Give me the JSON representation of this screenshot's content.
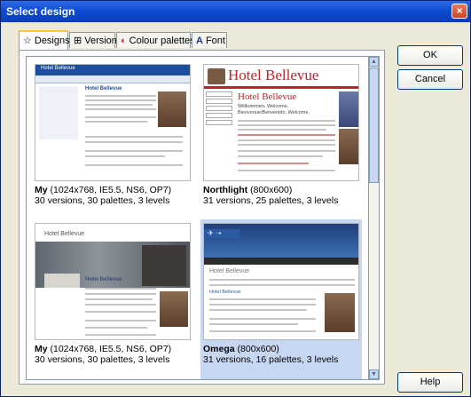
{
  "window": {
    "title": "Select design",
    "close_glyph": "×"
  },
  "tabs": [
    {
      "label": "Designs",
      "icon": "star-icon"
    },
    {
      "label": "Versions",
      "icon": "grid-icon"
    },
    {
      "label": "Colour palettes",
      "icon": "palette-icon"
    },
    {
      "label": "Font",
      "icon": "font-icon"
    }
  ],
  "designs": [
    {
      "name": "My",
      "spec": " (1024x768, IE5.5, NS6, OP7)",
      "details": "30 versions, 30 palettes, 3 levels",
      "thumb_title": "Hotel Bellevue",
      "thumb_heading": "Hotel Bellevue"
    },
    {
      "name": "Northlight",
      "spec": " (800x600)",
      "details": "31 versions, 25 palettes, 3 levels",
      "thumb_title": "Hotel Bellevue",
      "thumb_heading": "Hotel Bellevue",
      "thumb_sub": "Willkommen, Welcome, Bienvenue/Benvenido, Welcome,"
    },
    {
      "name": "My",
      "spec": " (1024x768, IE5.5, NS6, OP7)",
      "details": "30 versions, 30 palettes, 3 levels",
      "thumb_title": "Hotel Bellevue",
      "thumb_heading": "Hotel Bellevue"
    },
    {
      "name": "Omega",
      "spec": " (800x600)",
      "details": "31 versions, 16 palettes, 3 levels",
      "thumb_title": "Hotel Bellevue",
      "thumb_heading": "Hotel Bellevue"
    }
  ],
  "buttons": {
    "ok": "OK",
    "cancel": "Cancel",
    "help": "Help"
  },
  "colors": {
    "titlebar": "#0b4ad0",
    "selection": "#c7d7f2",
    "accent_red": "#b5262a"
  }
}
